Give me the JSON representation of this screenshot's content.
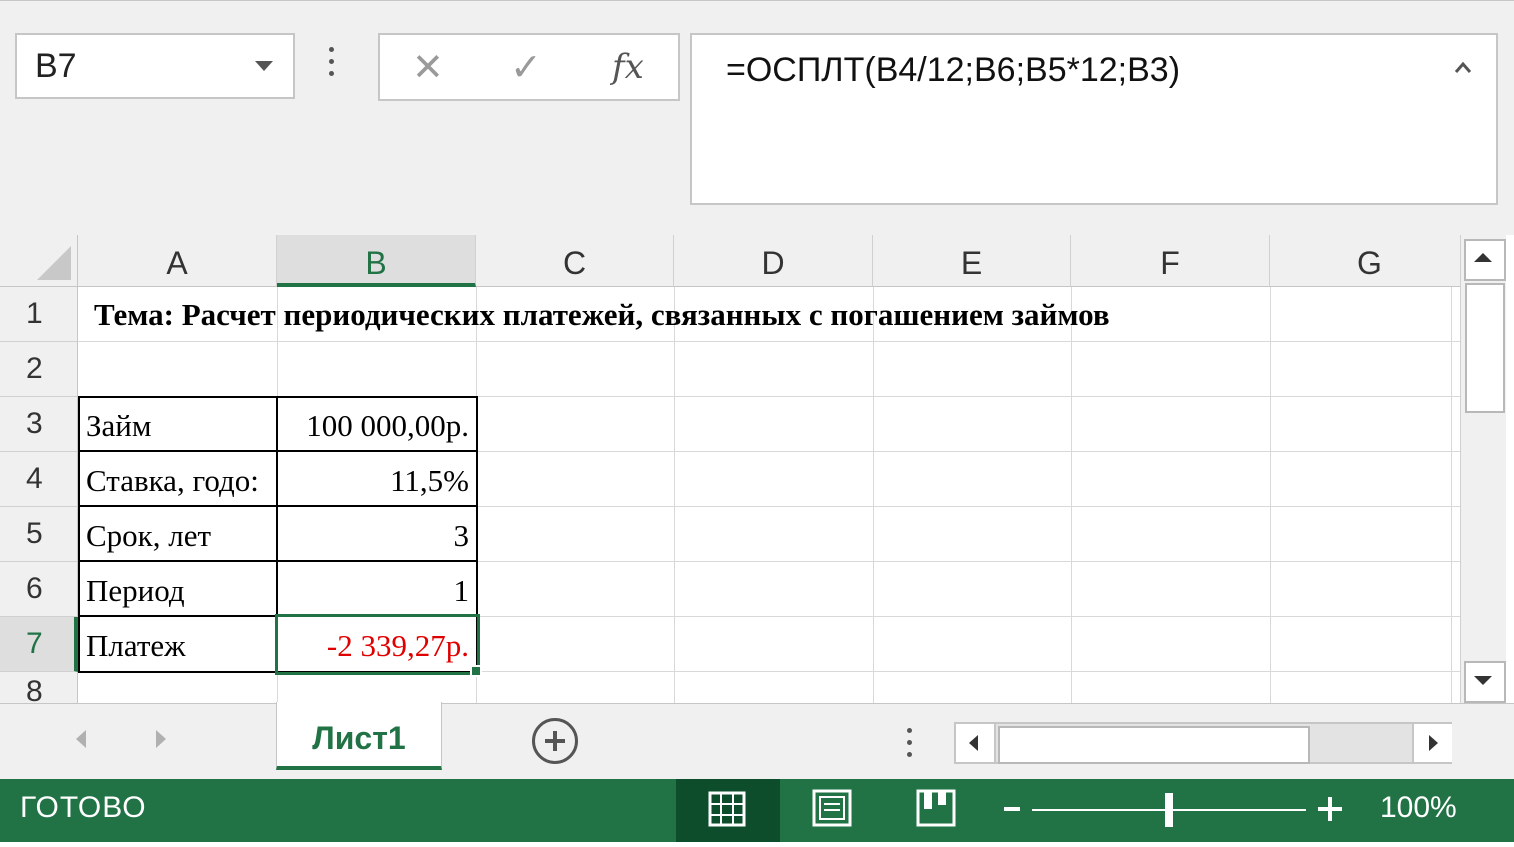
{
  "name_box": {
    "value": "B7"
  },
  "formula_bar": {
    "cancel_glyph": "✕",
    "enter_glyph": "✓",
    "fx_label": "fx",
    "formula": "=ОСПЛТ(B4/12;B6;B5*12;B3)"
  },
  "columns": [
    "A",
    "B",
    "C",
    "D",
    "E",
    "F",
    "G"
  ],
  "selected_column": "B",
  "rows": [
    "1",
    "2",
    "3",
    "4",
    "5",
    "6",
    "7",
    "8"
  ],
  "selected_row": "7",
  "cells": {
    "A1": "Тема: Расчет периодических платежей, связанных с погашением займов",
    "A3": "Займ",
    "B3": "100 000,00р.",
    "A4": "Ставка, годо:",
    "B4": "11,5%",
    "A5": "Срок, лет",
    "B5": "3",
    "A6": "Период",
    "B6": "1",
    "A7": "Платеж",
    "B7": "-2 339,27р."
  },
  "colors": {
    "accent": "#217346",
    "negative_value": "#e00000"
  },
  "sheet_tabs": [
    {
      "label": "Лист1",
      "active": true
    }
  ],
  "status_bar": {
    "status": "ГОТОВО",
    "zoom_level": "100%",
    "zoom_fraction": 0.5
  },
  "icons": {
    "namebox_dropdown": "chevron-down-icon",
    "add_sheet": "plus-circle-icon",
    "view_normal": "grid-view-icon",
    "view_page_layout": "page-layout-icon",
    "view_page_break": "page-break-preview-icon"
  }
}
